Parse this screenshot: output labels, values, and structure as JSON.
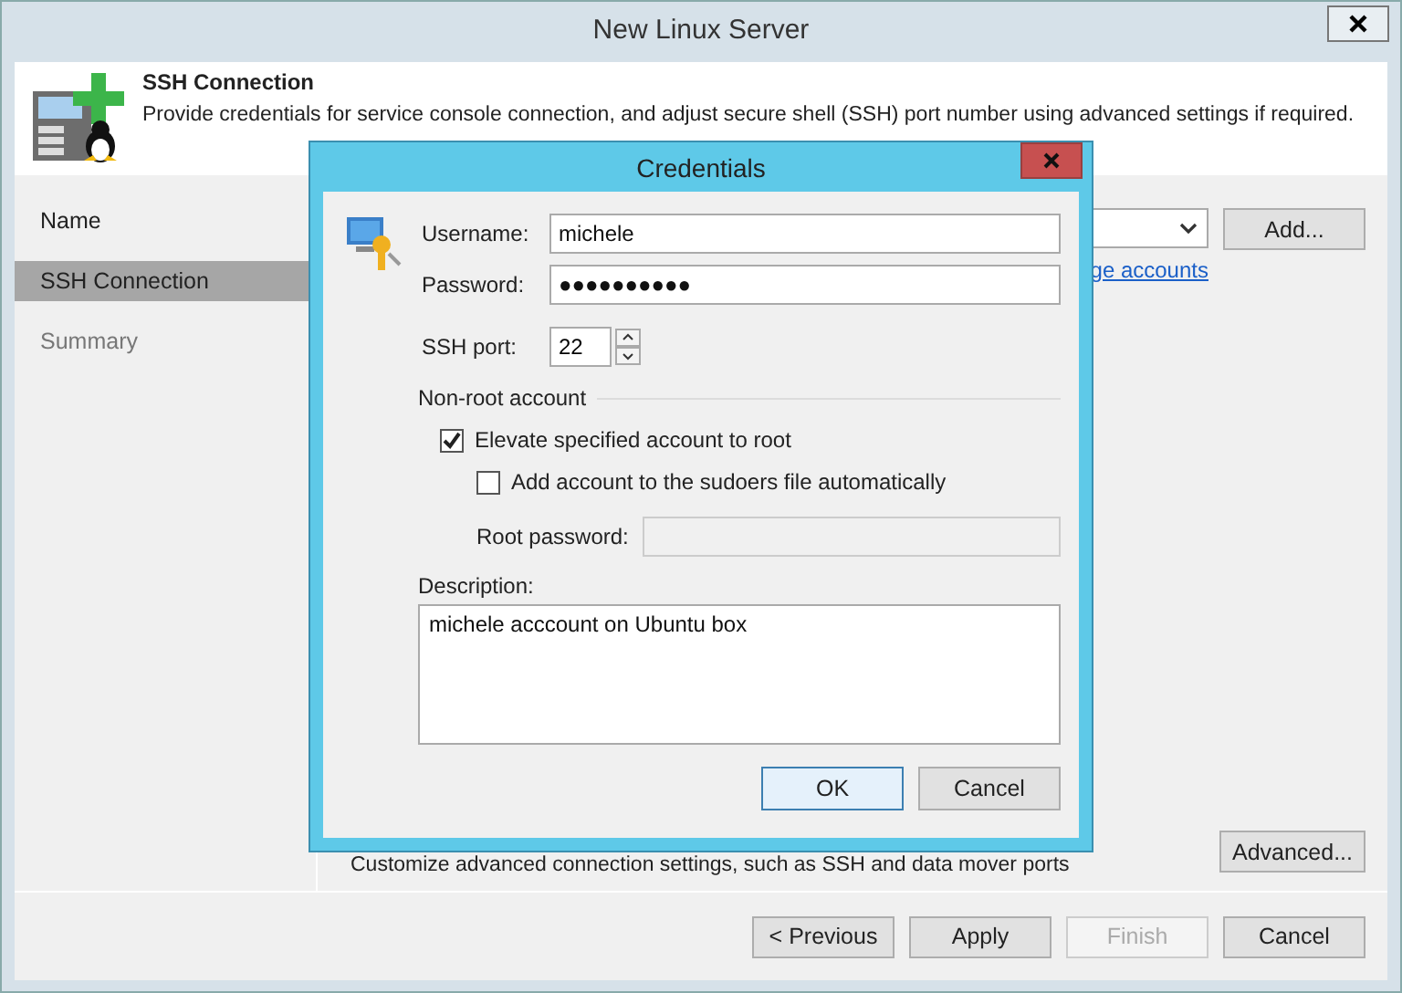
{
  "window": {
    "title": "New Linux Server"
  },
  "header": {
    "title": "SSH Connection",
    "description": "Provide credentials for service console connection, and adjust secure shell (SSH) port number using advanced settings if required."
  },
  "steps": [
    {
      "label": "Name",
      "selected": false,
      "disabled": false
    },
    {
      "label": "SSH Connection",
      "selected": true,
      "disabled": false
    },
    {
      "label": "Summary",
      "selected": false,
      "disabled": true
    }
  ],
  "account": {
    "link": "ge accounts",
    "add_button": "Add..."
  },
  "advanced": {
    "description": "Customize advanced connection settings, such as SSH and data mover ports",
    "button": "Advanced..."
  },
  "footer_buttons": [
    {
      "label": "< Previous",
      "disabled": false
    },
    {
      "label": "Apply",
      "disabled": false
    },
    {
      "label": "Finish",
      "disabled": true
    },
    {
      "label": "Cancel",
      "disabled": false
    }
  ],
  "dialog": {
    "title": "Credentials",
    "username": {
      "label": "Username:",
      "value": "michele"
    },
    "password": {
      "label": "Password:",
      "value": "●●●●●●●●●●"
    },
    "ssh_port": {
      "label": "SSH port:",
      "value": "22"
    },
    "section": "Non-root account",
    "checkboxes": [
      {
        "label": "Elevate specified account to root",
        "checked": true
      },
      {
        "label": "Add account to the sudoers file automatically",
        "checked": false
      }
    ],
    "root_password": {
      "label": "Root password:",
      "disabled": true
    },
    "description": {
      "label": "Description:",
      "value": "michele acccount on Ubuntu box"
    },
    "buttons": [
      {
        "label": "OK",
        "default": true
      },
      {
        "label": "Cancel",
        "default": false
      }
    ]
  }
}
